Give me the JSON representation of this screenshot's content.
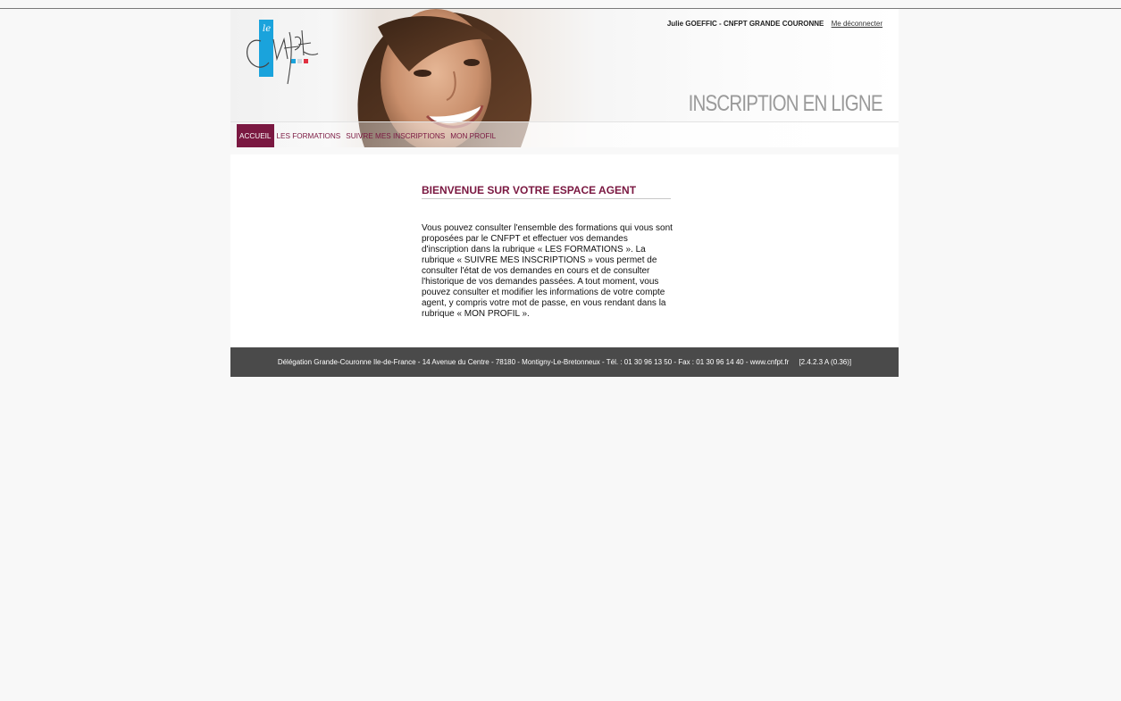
{
  "user": {
    "name": "Julie GOEFFIC - CNFPT GRANDE COURONNE",
    "logout_label": "Me déconnecter"
  },
  "header": {
    "title": "INSCRIPTION EN LIGNE",
    "logo_text": "le"
  },
  "nav": {
    "items": [
      {
        "label": "ACCUEIL",
        "active": true
      },
      {
        "label": "LES FORMATIONS",
        "active": false
      },
      {
        "label": "SUIVRE MES INSCRIPTIONS",
        "active": false
      },
      {
        "label": "MON PROFIL",
        "active": false
      }
    ]
  },
  "main": {
    "title": "BIENVENUE SUR VOTRE ESPACE AGENT",
    "body": "Vous pouvez consulter l'ensemble des formations qui vous sont proposées par le CNFPT et effectuer vos demandes d'inscription dans la rubrique « LES FORMATIONS ». La rubrique « SUIVRE MES INSCRIPTIONS » vous permet de consulter l'état de vos demandes en cours et de consulter l'historique de vos demandes passées. A tout moment, vous pouvez consulter et modifier les informations de votre compte agent, y compris votre mot de passe, en vous rendant dans la rubrique « MON PROFIL »."
  },
  "footer": {
    "text": "Délégation Grande-Couronne Ile-de-France - 14 Avenue du Centre - 78180 - Montigny-Le-Bretonneux - Tél. : 01 30 96 13 50 - Fax : 01 30 96 14 40 - www.cnfpt.fr",
    "version": "[2.4.2.3 A (0.36)]"
  },
  "colors": {
    "accent": "#7a1841",
    "footer_bg": "#4a4a4a",
    "logo_blue": "#1aa3dc",
    "logo_red": "#e03040"
  }
}
